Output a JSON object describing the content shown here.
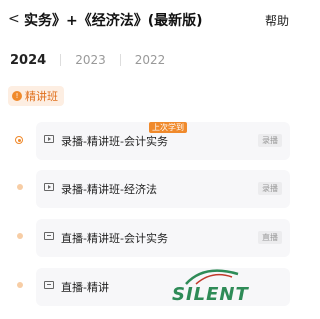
{
  "header": {
    "back_glyph": "<",
    "title": "实务》+《经济法》(最新版)",
    "help_label": "帮助"
  },
  "years": [
    "2024",
    "2023",
    "2022"
  ],
  "active_year": "2024",
  "class_badge": {
    "label": "精讲班",
    "color": "#f08a2c"
  },
  "last_learned_label": "上次学到",
  "lessons": [
    {
      "type": "play-icon",
      "label": "录播-精讲班-会计实务",
      "tag": "录播",
      "current": true
    },
    {
      "type": "play-icon",
      "label": "录播-精讲班-经济法",
      "tag": "录播",
      "current": false
    },
    {
      "type": "live-icon",
      "label": "直播-精讲班-会计实务",
      "tag": "直播",
      "current": false
    },
    {
      "type": "live-icon",
      "label": "直播-精讲",
      "tag": "",
      "current": false
    }
  ],
  "watermark": {
    "text": "SILENT",
    "color": "#2e8b57"
  }
}
